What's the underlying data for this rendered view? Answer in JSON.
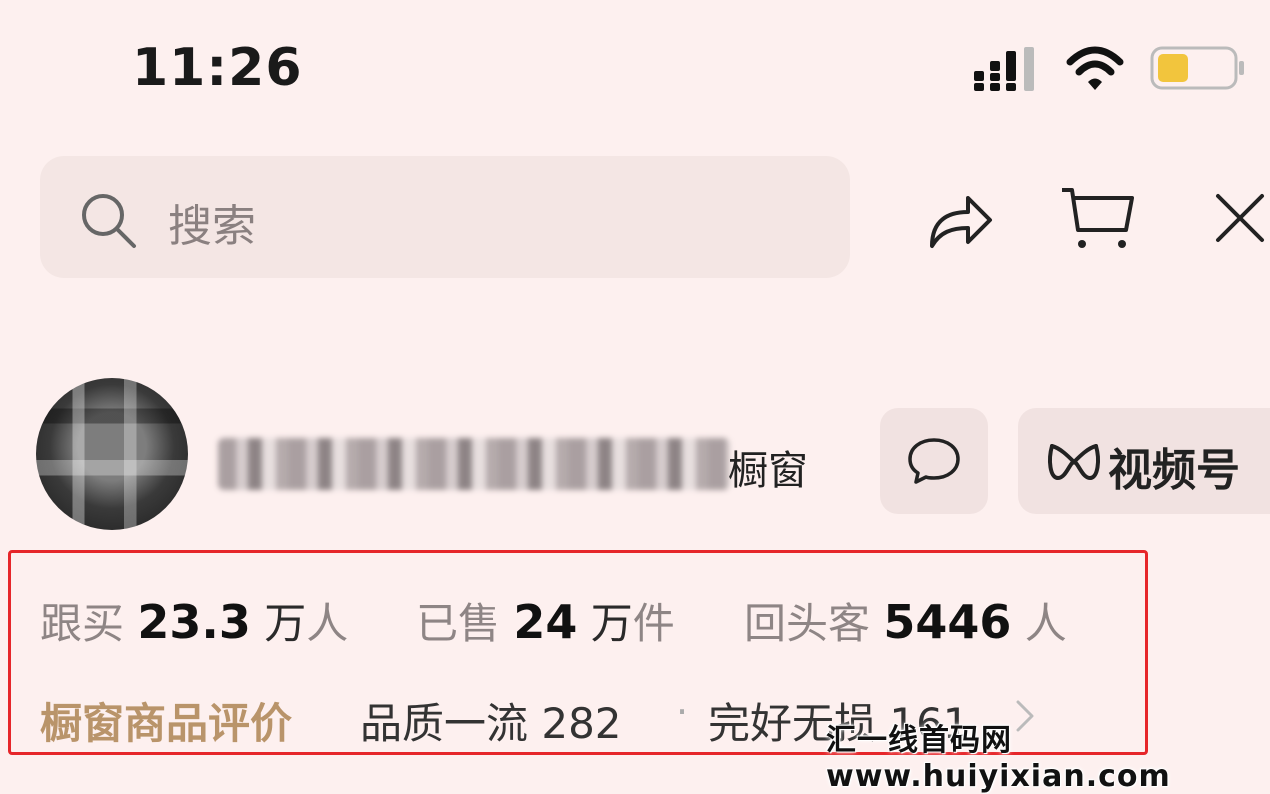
{
  "status_bar": {
    "time": "11:26",
    "battery_color": "#f2c53d"
  },
  "search": {
    "placeholder": "搜索"
  },
  "toolbar": {
    "share_icon": "share-icon",
    "cart_icon": "cart-icon",
    "close_icon": "close-icon"
  },
  "shop": {
    "name_suffix": "橱窗",
    "channels_label": "视频号"
  },
  "stats": {
    "followers_label": "跟买",
    "followers_value": "23.3",
    "followers_unit1": "万",
    "followers_unit2": "人",
    "sold_label": "已售",
    "sold_value": "24",
    "sold_unit1": "万",
    "sold_unit2": "件",
    "returning_label": "回头客",
    "returning_value": "5446",
    "returning_unit": "人"
  },
  "reviews": {
    "label": "橱窗商品评价",
    "item1": "品质一流 282",
    "separator": "·",
    "item2": "完好无损 161"
  },
  "watermark": "汇一线首码网 www.huiyixian.com",
  "colors": {
    "background": "#fdf0ef",
    "highlight_border": "#e6262a",
    "review_label": "#b9946a"
  }
}
